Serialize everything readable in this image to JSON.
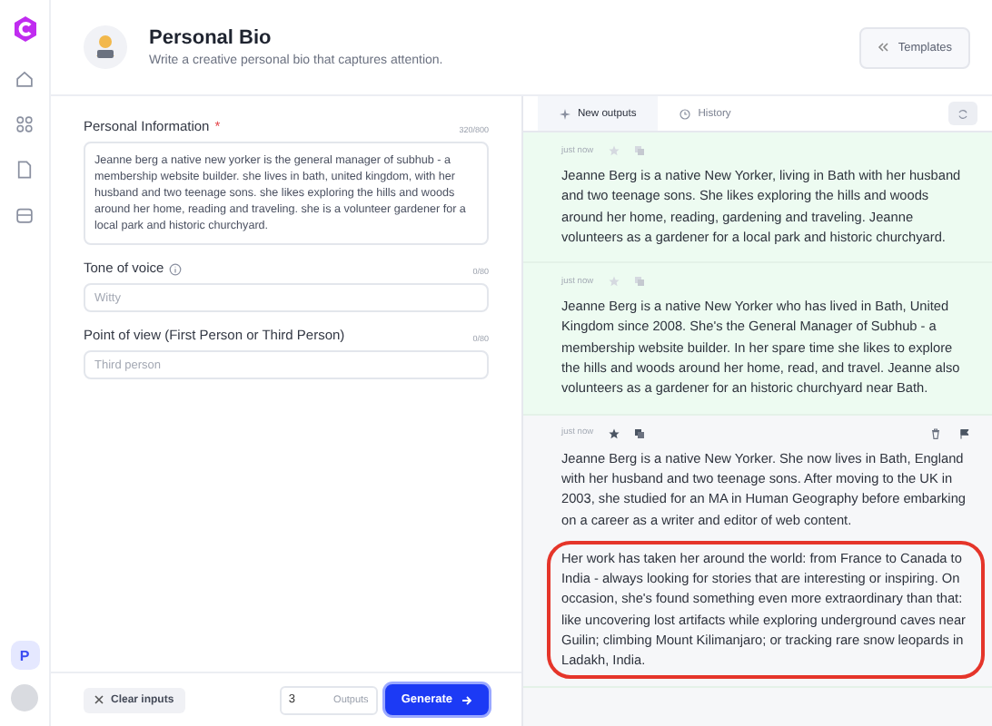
{
  "header": {
    "title": "Personal Bio",
    "subtitle": "Write a creative personal bio that captures attention.",
    "templates_button": "Templates"
  },
  "sidebar": {
    "items": [
      {
        "kind": "home",
        "selected": false
      },
      {
        "kind": "apps",
        "selected": false
      },
      {
        "kind": "document",
        "selected": false
      },
      {
        "kind": "archive",
        "selected": false
      }
    ],
    "user_initial": "P"
  },
  "form": {
    "fields": [
      {
        "kind": "textarea",
        "label": "Personal Information",
        "required_mark": "*",
        "info": false,
        "counter": "320/800",
        "value": "Jeanne berg a native new yorker is the general manager of subhub - a membership website builder. she lives in bath, united kingdom, with her husband and two teenage sons. she likes exploring the hills and woods around her home, reading and traveling. she is a volunteer gardener for a local park and historic churchyard."
      },
      {
        "kind": "input",
        "label": "Tone of voice",
        "info": true,
        "counter": "0/80",
        "placeholder": "Witty"
      },
      {
        "kind": "input",
        "label": "Point of view (First Person or Third Person)",
        "info": false,
        "counter": "0/80",
        "placeholder": "Third person"
      }
    ],
    "clear_button": "Clear inputs",
    "outputs_count": "3",
    "outputs_label": "Outputs",
    "generate_button": "Generate"
  },
  "tabs": [
    {
      "label": "New outputs",
      "selected": true
    },
    {
      "label": "History",
      "selected": false
    }
  ],
  "outputs": [
    {
      "time": "just now",
      "selected": false,
      "paragraphs": [
        {
          "text": "Jeanne Berg is a native New Yorker, living in Bath with her husband and two teenage sons. She likes exploring the hills and woods around her home, reading, gardening and traveling. Jeanne volunteers as a gardener for a local park and historic churchyard.",
          "highlighted": false
        }
      ]
    },
    {
      "time": "just now",
      "selected": false,
      "paragraphs": [
        {
          "text": "Jeanne Berg is a native New Yorker who has lived in Bath, United Kingdom since 2008. She's the General Manager of Subhub - a membership website builder. In her spare time she likes to explore the hills and woods around her home, read, and travel. Jeanne also volunteers as a gardener for an historic churchyard near Bath.",
          "highlighted": false
        }
      ]
    },
    {
      "time": "just now",
      "selected": true,
      "paragraphs": [
        {
          "text": "Jeanne Berg is a native New Yorker. She now lives in Bath, England with her husband and two teenage sons. After moving to the UK in 2003, she studied for an MA in Human Geography before embarking on a career as a writer and editor of web content.",
          "highlighted": false
        },
        {
          "text": "Her work has taken her around the world: from France to Canada to India - always looking for stories that are interesting or inspiring. On occasion, she's found something even more extraordinary than that: like uncovering lost artifacts while exploring underground caves near Guilin; climbing Mount Kilimanjaro; or tracking rare snow leopards in Ladakh, India.",
          "highlighted": true
        }
      ]
    }
  ]
}
